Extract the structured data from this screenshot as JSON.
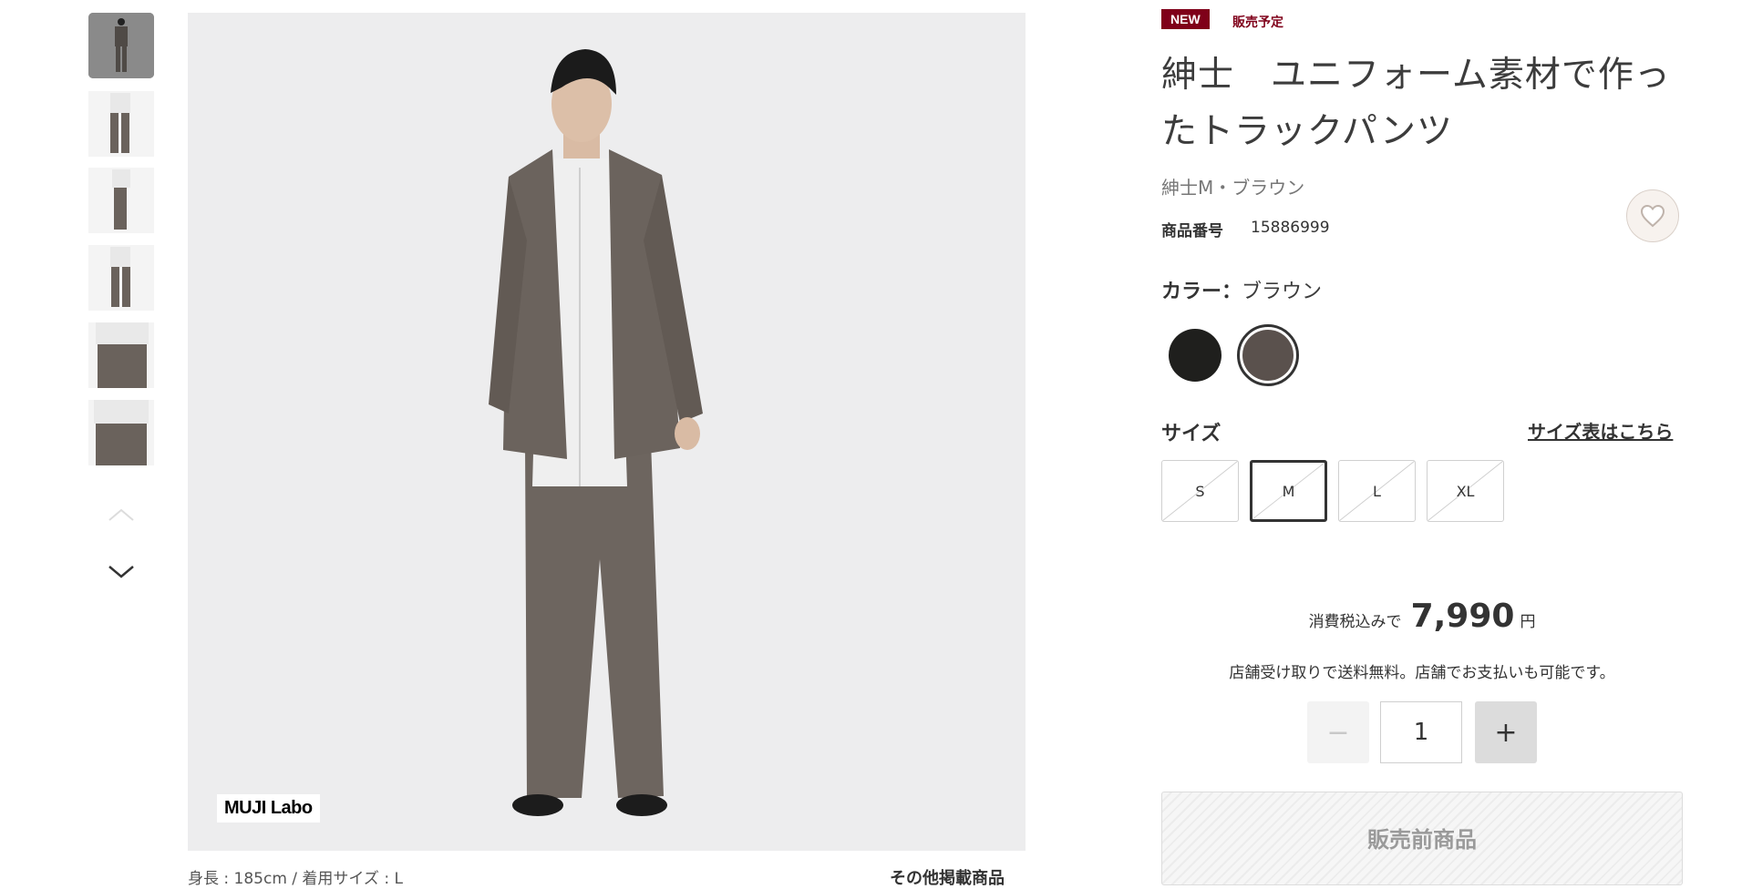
{
  "gallery": {
    "thumbnails": [
      {
        "alt": "thumbnail-1"
      },
      {
        "alt": "thumbnail-2"
      },
      {
        "alt": "thumbnail-3"
      },
      {
        "alt": "thumbnail-4"
      },
      {
        "alt": "thumbnail-5"
      },
      {
        "alt": "thumbnail-6"
      }
    ],
    "brand_logo": "MUJI Labo",
    "caption": "身長 : 185cm / 着用サイズ : L",
    "other_items_link": "その他掲載商品"
  },
  "product": {
    "badge_new": "NEW",
    "badge_status": "販売予定",
    "title": "紳士　ユニフォーム素材で作ったトラックパンツ",
    "subtitle": "紳士M・ブラウン",
    "product_number_label": "商品番号",
    "product_number": "15886999"
  },
  "color": {
    "label": "カラー：",
    "selected": "ブラウン",
    "swatches": [
      {
        "name": "ブラック",
        "hex": "#1f1f1d"
      },
      {
        "name": "ブラウン",
        "hex": "#5a514d"
      }
    ]
  },
  "size": {
    "label": "サイズ",
    "chart_link": "サイズ表はこちら",
    "options": [
      "S",
      "M",
      "L",
      "XL"
    ],
    "selected": "M"
  },
  "price": {
    "prefix": "消費税込みで",
    "value": "7,990",
    "unit": "円"
  },
  "notice": "店舗受け取りで送料無料。店舗でお支払いも可能です。",
  "quantity": {
    "minus": "−",
    "value": "1",
    "plus": "+"
  },
  "buy_button": "販売前商品"
}
